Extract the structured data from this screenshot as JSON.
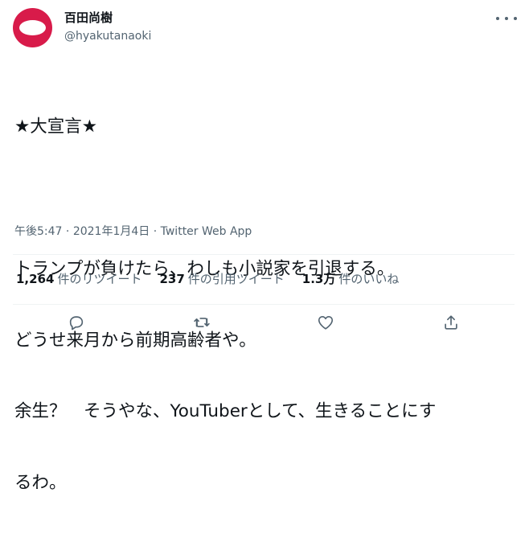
{
  "user": {
    "display_name": "百田尚樹",
    "handle": "@hyakutanaoki",
    "avatar_color": "#d81b4a"
  },
  "tweet": {
    "lines": [
      "★大宣言★",
      "",
      "トランプが負けたら、わしも小説家を引退する。",
      "どうせ来月から前期高齢者や。",
      "余生？　そうやな、YouTuberとして、生きることにす",
      "るわ。"
    ],
    "time": "午後5:47",
    "date": "2021年1月4日",
    "source": "Twitter Web App"
  },
  "stats": {
    "retweets_count": "1,264",
    "retweets_label": "件のリツイート",
    "quotes_count": "237",
    "quotes_label": "件の引用ツイート",
    "likes_count": "1.3万",
    "likes_label": "件のいいね"
  },
  "icons": {
    "more": "more-dots-icon",
    "reply": "reply-icon",
    "retweet": "retweet-icon",
    "like": "like-icon",
    "share": "share-icon"
  },
  "colors": {
    "text": "#0f1419",
    "secondary": "#536471",
    "divider": "#eff3f4"
  }
}
